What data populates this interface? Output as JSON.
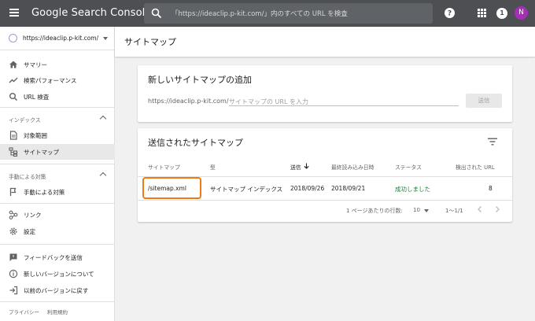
{
  "header": {
    "app_title": "Google Search Console",
    "search_placeholder": "「https://ideaclip.p-kit.com/」内のすべての URL を検査",
    "notification_count": "1",
    "avatar_initial": "N",
    "avatar_color": "#a52fb6"
  },
  "sidebar": {
    "property": "https://ideaclip.p-kit.com/",
    "items": [
      {
        "label": "サマリー",
        "icon": "home-icon"
      },
      {
        "label": "検索パフォーマンス",
        "icon": "trending-icon"
      },
      {
        "label": "URL 検査",
        "icon": "search-icon"
      }
    ],
    "index_section": "インデックス",
    "index_items": [
      {
        "label": "対象範囲",
        "icon": "coverage-icon"
      },
      {
        "label": "サイトマップ",
        "icon": "sitemap-icon",
        "active": true
      }
    ],
    "manual_section": "手動による対策",
    "manual_items": [
      {
        "label": "手動による対策",
        "icon": "flag-icon"
      }
    ],
    "other_items": [
      {
        "label": "リンク",
        "icon": "links-icon"
      },
      {
        "label": "設定",
        "icon": "settings-icon"
      }
    ],
    "bottom_items": [
      {
        "label": "フィードバックを送信",
        "icon": "feedback-icon"
      },
      {
        "label": "新しいバージョンについて",
        "icon": "info-icon"
      },
      {
        "label": "以前のバージョンに戻す",
        "icon": "exit-icon"
      }
    ],
    "footer": {
      "privacy": "プライバシー",
      "terms": "利用規約"
    }
  },
  "main": {
    "page_title": "サイトマップ",
    "add_card": {
      "title": "新しいサイトマップの追加",
      "url_prefix": "https://ideaclip.p-kit.com/",
      "input_placeholder": "サイトマップの URL を入力",
      "submit_label": "送信"
    },
    "submitted_card": {
      "title": "送信されたサイトマップ",
      "columns": [
        "サイトマップ",
        "型",
        "送信",
        "最終読み込み日時",
        "ステータス",
        "検出された URL"
      ],
      "rows": [
        {
          "sitemap": "/sitemap.xml",
          "type": "サイトマップ インデックス",
          "submitted": "2018/09/26",
          "last_read": "2018/09/21",
          "status": "成功しました",
          "discovered": "8"
        }
      ],
      "pagination": {
        "rows_per_page_label": "1 ページあたりの行数:",
        "rows_per_page": "10",
        "range": "1〜1/1"
      }
    }
  },
  "colors": {
    "topbar": "#4d4f53",
    "success": "#188038",
    "highlight": "#f07914"
  }
}
